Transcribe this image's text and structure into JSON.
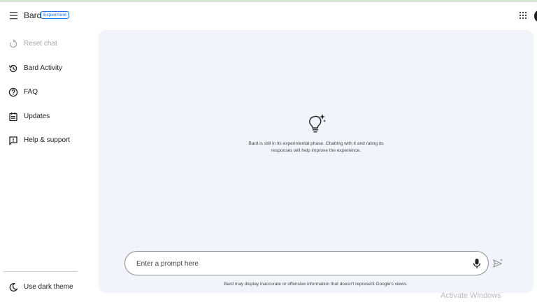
{
  "header": {
    "brand": "Bard",
    "badge": "Experiment"
  },
  "sidebar": {
    "items": [
      {
        "label": "Reset chat",
        "icon": "reset-icon",
        "disabled": true
      },
      {
        "label": "Bard Activity",
        "icon": "history-icon"
      },
      {
        "label": "FAQ",
        "icon": "help-circle-icon"
      },
      {
        "label": "Updates",
        "icon": "updates-icon"
      },
      {
        "label": "Help & support",
        "icon": "feedback-icon"
      }
    ],
    "dark_theme_label": "Use dark theme"
  },
  "main": {
    "intro_icon": "lightbulb-sparkle-icon",
    "intro_text": "Bard is still in its experimental phase. Chatting with it and rating its responses will help improve the experience.",
    "prompt_placeholder": "Enter a prompt here",
    "disclaimer": "Bard may display inaccurate or offensive information that doesn't represent Google's views."
  },
  "overlay": {
    "watermark": "Activate Windows"
  },
  "colors": {
    "main_bg": "#f1f4fb",
    "accent": "#1a73e8",
    "text": "#1f1f1f"
  }
}
